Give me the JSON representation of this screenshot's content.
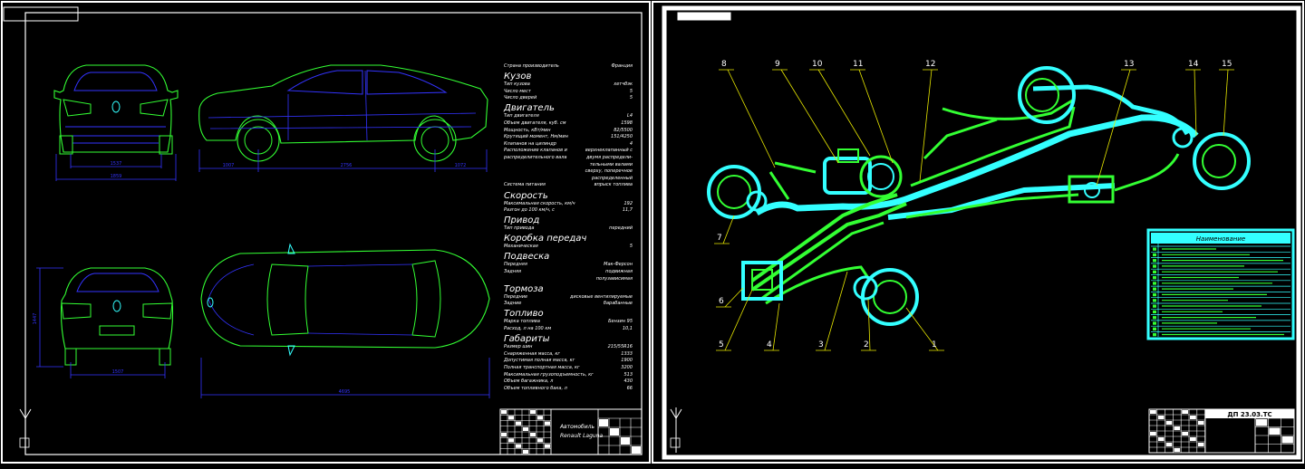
{
  "sheet1": {
    "specs": [
      {
        "k": "Страна производитель",
        "v": "Франция",
        "h": 0
      },
      {
        "k": "Кузов",
        "v": "",
        "h": 1
      },
      {
        "k": "Тип кузова",
        "v": "хетчбэк",
        "h": 0
      },
      {
        "k": "Число мест",
        "v": "5",
        "h": 0
      },
      {
        "k": "Число дверей",
        "v": "5",
        "h": 0
      },
      {
        "k": "Двигатель",
        "v": "",
        "h": 1
      },
      {
        "k": "Тип двигателя",
        "v": "L4",
        "h": 0
      },
      {
        "k": "Объем двигателя, куб. см",
        "v": "1598",
        "h": 0
      },
      {
        "k": "Мощность, кВт/мин",
        "v": "82/5500",
        "h": 0
      },
      {
        "k": "Крутящий момент, Нм/мин",
        "v": "151/4250",
        "h": 0
      },
      {
        "k": "Клапанов на цилиндр",
        "v": "4",
        "h": 0
      },
      {
        "k": "Расположение клапанов и",
        "v": "верхнеклапанный с",
        "h": 0
      },
      {
        "k": "распределительного вала",
        "v": "двумя распредели-",
        "h": 0
      },
      {
        "k": "",
        "v": "тельными валами",
        "h": 0
      },
      {
        "k": "",
        "v": "сверху, поперечное",
        "h": 0
      },
      {
        "k": "",
        "v": "распределенный",
        "h": 0
      },
      {
        "k": "Система питания",
        "v": "впрыск топлива",
        "h": 0
      },
      {
        "k": "Скорость",
        "v": "",
        "h": 1
      },
      {
        "k": "Максимальная скорость, км/ч",
        "v": "192",
        "h": 0
      },
      {
        "k": "Разгон до 100 км/ч, с",
        "v": "11,7",
        "h": 0
      },
      {
        "k": "Привод",
        "v": "",
        "h": 1
      },
      {
        "k": "Тип привода",
        "v": "передний",
        "h": 0
      },
      {
        "k": "Коробка передач",
        "v": "",
        "h": 1
      },
      {
        "k": "Механическая",
        "v": "5",
        "h": 0
      },
      {
        "k": "Подвеска",
        "v": "",
        "h": 1
      },
      {
        "k": "Передняя",
        "v": "Мак-Ферсон",
        "h": 0
      },
      {
        "k": "Задняя",
        "v": "подвижная",
        "h": 0
      },
      {
        "k": "",
        "v": "полузависимая",
        "h": 0
      },
      {
        "k": "Тормоза",
        "v": "",
        "h": 1
      },
      {
        "k": "Передние",
        "v": "дисковые вентилируемые",
        "h": 0
      },
      {
        "k": "Задние",
        "v": "барабанные",
        "h": 0
      },
      {
        "k": "Топливо",
        "v": "",
        "h": 1
      },
      {
        "k": "Марка топлива",
        "v": "Бензин 95",
        "h": 0
      },
      {
        "k": "Расход, л на 100 км",
        "v": "10,1",
        "h": 0
      },
      {
        "k": "Габариты",
        "v": "",
        "h": 1
      },
      {
        "k": "Размер шин",
        "v": "215/55R16",
        "h": 0
      },
      {
        "k": "Снаряженная масса, кг",
        "v": "1333",
        "h": 0
      },
      {
        "k": "Допустимая полная масса, кг",
        "v": "1900",
        "h": 0
      },
      {
        "k": "Полная транспортная масса, кг",
        "v": "3200",
        "h": 0
      },
      {
        "k": "Максимальная грузоподъемность, кг",
        "v": "513",
        "h": 0
      },
      {
        "k": "Объем багажника, л",
        "v": "430",
        "h": 0
      },
      {
        "k": "Объем топливного бака, л",
        "v": "66",
        "h": 0
      }
    ],
    "stamp": {
      "line1": "Автомобиль",
      "line2": "Renault Laguna"
    },
    "dims": {
      "front_track": "1537",
      "front_width": "1859",
      "wb_front": "1007",
      "wheelbase": "2756",
      "wb_rear": "1072",
      "height": "1447",
      "rear_track": "1507",
      "length": "4695"
    }
  },
  "sheet2": {
    "callouts": [
      "1",
      "2",
      "3",
      "4",
      "5",
      "6",
      "7",
      "8",
      "9",
      "10",
      "11",
      "12",
      "13",
      "14",
      "15"
    ],
    "stamp_code": "ДП 23.03.ТС",
    "legend_title": "Наименование"
  }
}
